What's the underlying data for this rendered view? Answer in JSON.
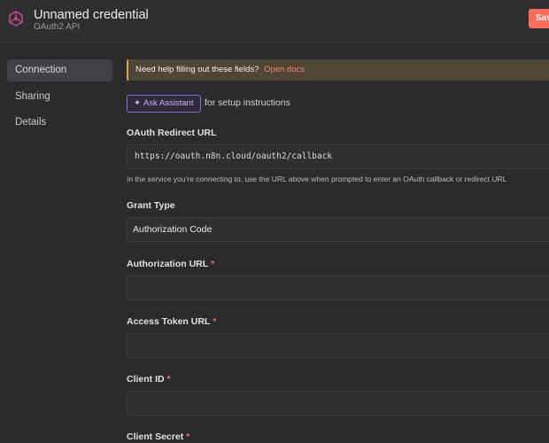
{
  "header": {
    "title": "Unnamed credential",
    "subtitle": "OAuth2 API",
    "save_label": "Save"
  },
  "sidebar": {
    "items": [
      {
        "label": "Connection"
      },
      {
        "label": "Sharing"
      },
      {
        "label": "Details"
      }
    ]
  },
  "banner": {
    "text": "Need help filling out these fields?",
    "link": "Open docs"
  },
  "assistant": {
    "button_label": "Ask Assistant",
    "note": "for setup instructions"
  },
  "fields": {
    "redirect": {
      "label": "OAuth Redirect URL",
      "value": "https://oauth.n8n.cloud/oauth2/callback",
      "help": "In the service you're connecting to, use the URL above when prompted to enter an OAuth callback or redirect URL"
    },
    "grant": {
      "label": "Grant Type",
      "value": "Authorization Code"
    },
    "auth_url": {
      "label": "Authorization URL",
      "required": "*",
      "value": ""
    },
    "token_url": {
      "label": "Access Token URL",
      "required": "*",
      "value": ""
    },
    "client_id": {
      "label": "Client ID",
      "required": "*",
      "value": ""
    },
    "client_secret": {
      "label": "Client Secret",
      "required": "*"
    }
  },
  "colors": {
    "accent": "#ff6d5a",
    "assistant": "#8a6cd8",
    "banner_border": "#d9a441"
  },
  "icons": {
    "logo": "n8n-logo-icon",
    "assistant": "sparkle-icon"
  }
}
